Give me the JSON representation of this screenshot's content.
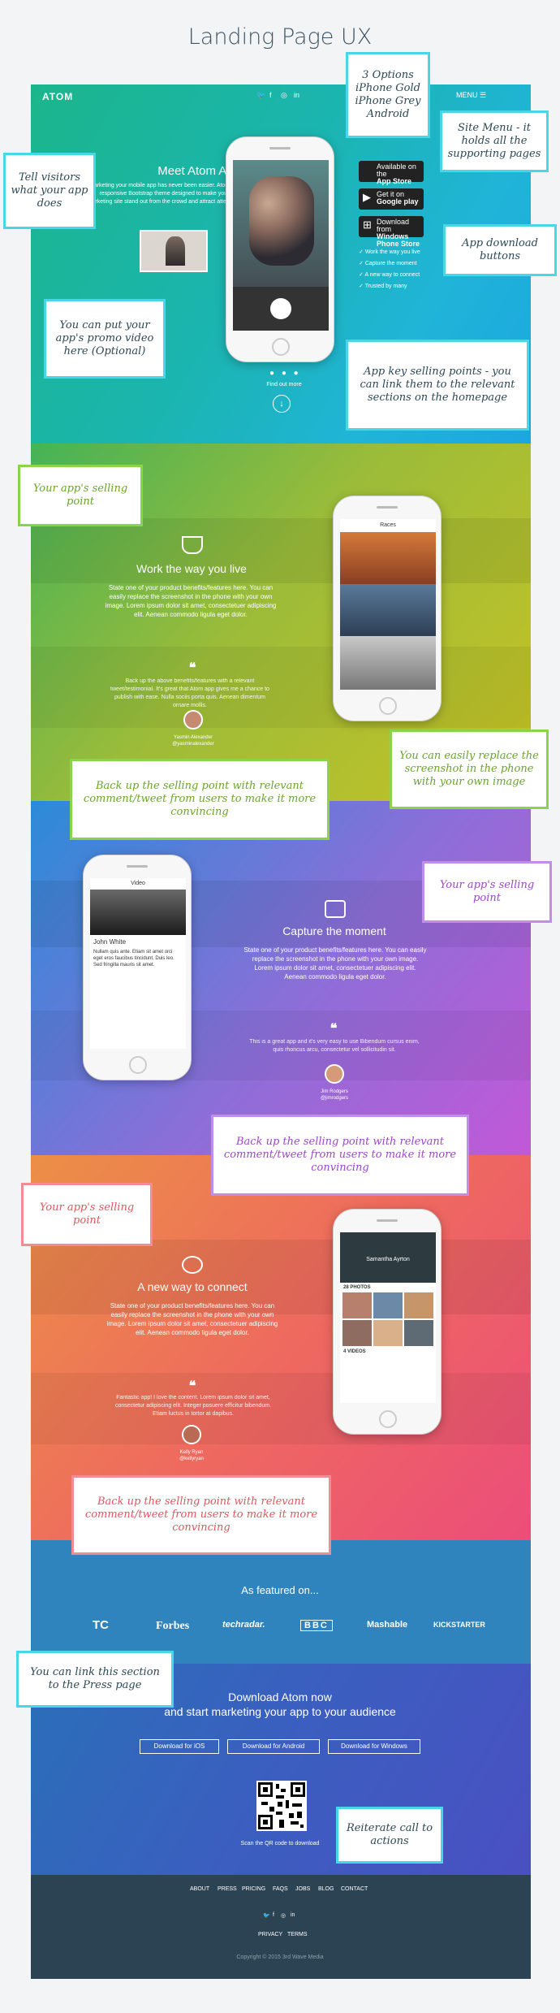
{
  "title": "Landing Page UX",
  "nav": {
    "logo": "ATOM",
    "menu": "MENU ☰",
    "social": [
      "🐦",
      "f",
      "◎",
      "in"
    ]
  },
  "hero": {
    "heading": "Meet Atom App",
    "description": "Marketing your mobile app has never been easier. Atom is a responsive Bootstrap theme designed to make your app marketing site stand out from the crowd and attract attention.",
    "store_buttons": [
      {
        "small": "Available on the",
        "big": "App Store",
        "icon": "apple-icon"
      },
      {
        "small": "Get it on",
        "big": "Google play",
        "icon": "play-icon"
      },
      {
        "small": "Download from",
        "big": "Windows Phone Store",
        "icon": "windows-icon"
      }
    ],
    "checks": [
      "Work the way you live",
      "Capture the moment",
      "A new way to connect",
      "Trusted by many"
    ],
    "find_out": "Find out more",
    "dots": "● ● ●",
    "arrow": "↓"
  },
  "section1": {
    "title": "Work the way you live",
    "text": "State one of your product benefits/features here. You can easily replace the screenshot in the phone with your own image. Lorem ipsum dolor sit amet, consectetuer adipiscing elit. Aenean commodo ligula eget dolor.",
    "quote": "Back up the above benefits/features with a relevant tweet/testimonial. It's great that Atom app gives me a chance to publish with ease. Nulla sociis porta quis. Aenean dimentum ornare mollis.",
    "name": "Yasmin Alexander",
    "handle": "@yasminalexander",
    "phone_title": "Races"
  },
  "section2": {
    "title": "Capture the moment",
    "text": "State one of your product benefits/features here. You can easily replace the screenshot in the phone with your own image. Lorem ipsum dolor sit amet, consectetuer adipiscing elit. Aenean commodo ligula eget dolor.",
    "quote": "This is a great app and it's very easy to use Bibendum cursus enim, quis rhoncus arcu, consectetur vel sollicitudin sit.",
    "name": "Jim Rodgers",
    "handle": "@jimrodgers",
    "phone_title": "Video",
    "user": "John White",
    "comment": "Nullam quis ante. Etiam sit amet orci eget eros faucibus tincidunt. Duis leo. Sed fringilla mauris sit amet."
  },
  "section3": {
    "title": "A new way to connect",
    "text": "State one of your product benefits/features here. You can easily replace the screenshot in the phone with your own image. Lorem ipsum dolor sit amet, consectetuer adipiscing elit. Aenean commodo ligula eget dolor.",
    "quote": "Fantastic app! I love the content. Lorem ipsum dolor sit amet, consectetur adipiscing elit. Integer posuere efficitur bibendum. Etiam luctus in tortor at dapibus.",
    "name": "Kelly Ryan",
    "handle": "@kellyryan",
    "phone_user": "Samantha Ayrton",
    "photos_label": "28 PHOTOS",
    "videos_label": "4 VIDEOS"
  },
  "press": {
    "heading": "As featured on...",
    "logos": [
      "TC",
      "Forbes",
      "techradar.",
      "BBC",
      "Mashable",
      "KICKSTARTER"
    ]
  },
  "download": {
    "line1": "Download Atom now",
    "line2": "and start marketing your app to your audience",
    "buttons": [
      "Download for iOS",
      "Download for Android",
      "Download for Windows"
    ],
    "qr_label": "Scan the QR code to download"
  },
  "footer": {
    "links": [
      "ABOUT",
      "PRESS",
      "PRICING",
      "FAQS",
      "JOBS",
      "BLOG",
      "CONTACT"
    ],
    "social": [
      "🐦",
      "f",
      "◎",
      "in"
    ],
    "legal": [
      "PRIVACY",
      "TERMS"
    ],
    "copyright": "Copyright © 2015 3rd Wave Media"
  },
  "notes": {
    "options": "3 Options\niPhone Gold\niPhone Grey\nAndroid",
    "menu": "Site Menu - it holds all the supporting pages",
    "tell": "Tell visitors what your app does",
    "download": "App download buttons",
    "video": "You can put your app's promo video here (Optional)",
    "selling": "App key selling points - you can link them to the relevant sections on the homepage",
    "sp1": "Your app's selling point",
    "replace": "You can easily replace the screenshot in the phone with your own image",
    "backup1": "Back up the selling point with relevant comment/tweet from users to make it more convincing",
    "sp2": "Your app's selling point",
    "backup2": "Back up the selling point with relevant comment/tweet from users to make it more convincing",
    "sp3": "Your app's selling point",
    "backup3": "Back up the selling point with relevant comment/tweet from users to make it more convincing",
    "press": "You can link this section to the Press page",
    "cta": "Reiterate call to actions"
  },
  "colors": {
    "hero": "#1bb5b0",
    "section1": "#8cba3f",
    "section2": "#8d6ed8",
    "section3": "#ee6a5e",
    "press": "#2f84bd",
    "download": "#3b5ec0",
    "footer": "#2b4352",
    "note_border": "#47d7e6"
  }
}
